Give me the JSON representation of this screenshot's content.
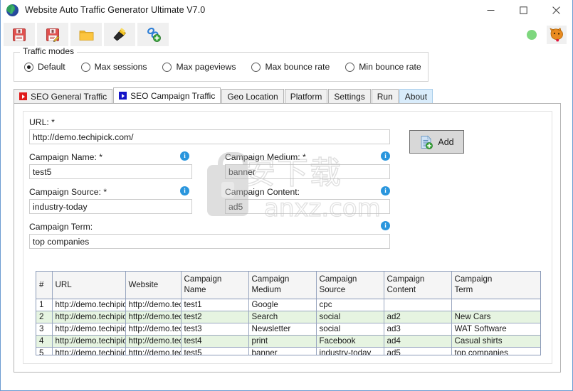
{
  "window": {
    "title": "Website Auto Traffic Generator Ultimate V7.0",
    "app_icon": "globe-icon",
    "minimize_label": "–",
    "maximize_label": "☐",
    "close_label": "✕"
  },
  "toolbar": {
    "buttons": [
      {
        "name": "save-button",
        "icon": "floppy-save-icon"
      },
      {
        "name": "save-as-button",
        "icon": "floppy-save-as-icon"
      },
      {
        "name": "open-button",
        "icon": "folder-open-icon"
      },
      {
        "name": "flashlight-button",
        "icon": "flashlight-icon"
      },
      {
        "name": "add-link-button",
        "icon": "link-add-icon"
      }
    ],
    "status_dot": {
      "name": "status-indicator",
      "color": "#7ed77e"
    },
    "fox_button": {
      "name": "fox-icon",
      "color": "#e98b20"
    }
  },
  "traffic_modes": {
    "group_title": "Traffic modes",
    "selected": "Default",
    "options": [
      {
        "label": "Default",
        "checked": true
      },
      {
        "label": "Max sessions",
        "checked": false
      },
      {
        "label": "Max pageviews",
        "checked": false
      },
      {
        "label": "Max bounce rate",
        "checked": false
      },
      {
        "label": "Min bounce rate",
        "checked": false
      }
    ]
  },
  "tabs": [
    {
      "label": "SEO General Traffic",
      "icon": "play-icon-red",
      "icon_color": "#e01b1b",
      "state": "normal"
    },
    {
      "label": "SEO Campaign Traffic",
      "icon": "play-icon-blue",
      "icon_color": "#1414c8",
      "state": "active"
    },
    {
      "label": "Geo Location",
      "icon": null,
      "state": "normal"
    },
    {
      "label": "Platform",
      "icon": null,
      "state": "normal"
    },
    {
      "label": "Settings",
      "icon": null,
      "state": "normal"
    },
    {
      "label": "Run",
      "icon": null,
      "state": "normal"
    },
    {
      "label": "About",
      "icon": null,
      "state": "hover"
    }
  ],
  "form": {
    "url": {
      "label": "URL: *",
      "value": "http://demo.techipick.com/",
      "placeholder": "http://"
    },
    "campaign_name": {
      "label": "Campaign Name: *",
      "value": "test5",
      "placeholder": "",
      "info": "info-icon"
    },
    "campaign_medium": {
      "label": "Campaign Medium: *",
      "value": "banner",
      "placeholder": "",
      "info": "info-icon"
    },
    "campaign_source": {
      "label": "Campaign Source: *",
      "value": "industry-today",
      "placeholder": "",
      "info": "info-icon"
    },
    "campaign_content": {
      "label": "Campaign Content:",
      "value": "ad5",
      "placeholder": "",
      "info": "info-icon"
    },
    "campaign_term": {
      "label": "Campaign Term:",
      "value": "top companies",
      "placeholder": "",
      "info": "info-icon"
    },
    "add_button": {
      "label": "Add",
      "icon": "document-add-icon"
    }
  },
  "grid": {
    "columns": [
      "#",
      "URL",
      "Website",
      "Campaign\nName",
      "Campaign\nMedium",
      "Campaign\nSource",
      "Campaign\nContent",
      "Campaign\nTerm"
    ],
    "columns_flat": [
      {
        "line1": "#",
        "line2": ""
      },
      {
        "line1": "URL",
        "line2": ""
      },
      {
        "line1": "Website",
        "line2": ""
      },
      {
        "line1": "Campaign",
        "line2": "Name"
      },
      {
        "line1": "Campaign",
        "line2": "Medium"
      },
      {
        "line1": "Campaign",
        "line2": "Source"
      },
      {
        "line1": "Campaign",
        "line2": "Content"
      },
      {
        "line1": "Campaign",
        "line2": "Term"
      }
    ],
    "rows": [
      {
        "num": "1",
        "url": "http://demo.techipick.com/",
        "website": "http://demo.techipick.com/",
        "name": "test1",
        "medium": "Google",
        "source": "cpc",
        "content": "",
        "term": "",
        "alt": false
      },
      {
        "num": "2",
        "url": "http://demo.techipick.com/",
        "website": "http://demo.techipick.com/",
        "name": "test2",
        "medium": "Search",
        "source": "social",
        "content": "ad2",
        "term": "New Cars",
        "alt": true
      },
      {
        "num": "3",
        "url": "http://demo.techipick.com/",
        "website": "http://demo.techipick.com/",
        "name": "test3",
        "medium": "Newsletter",
        "source": "social",
        "content": "ad3",
        "term": "WAT Software",
        "alt": false
      },
      {
        "num": "4",
        "url": "http://demo.techipick.com/",
        "website": "http://demo.techipick.com/",
        "name": "test4",
        "medium": "print",
        "source": "Facebook",
        "content": "ad4",
        "term": "Casual shirts",
        "alt": true
      },
      {
        "num": "5",
        "url": "http://demo.techipick.com/",
        "website": "http://demo.techipick.com/",
        "name": "test5",
        "medium": "banner",
        "source": "industry-today",
        "content": "ad5",
        "term": "top companies",
        "alt": false
      }
    ],
    "alt_row_color": "#e6f4e1"
  },
  "watermark": {
    "cjk": "安下载",
    "url": "anxz.com",
    "lock": "padlock-icon"
  }
}
